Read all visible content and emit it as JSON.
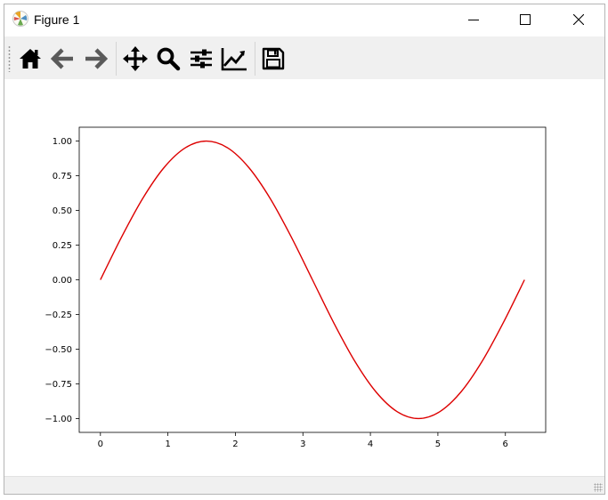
{
  "window": {
    "title": "Figure 1",
    "app_icon": "matplotlib-icon",
    "controls": [
      "minimize-icon",
      "maximize-icon",
      "close-icon"
    ]
  },
  "toolbar": {
    "tools": [
      {
        "name": "home",
        "icon": "home-icon"
      },
      {
        "name": "back",
        "icon": "arrow-left-icon"
      },
      {
        "name": "forward",
        "icon": "arrow-right-icon"
      },
      {
        "name": "pan",
        "icon": "move-icon"
      },
      {
        "name": "zoom",
        "icon": "magnifier-icon"
      },
      {
        "name": "subplots",
        "icon": "sliders-icon"
      },
      {
        "name": "edit-axes",
        "icon": "line-chart-icon"
      },
      {
        "name": "save",
        "icon": "floppy-disk-icon"
      }
    ]
  },
  "colors": {
    "line": "#dd0000",
    "toolbar_bg": "#f0f0f0"
  },
  "chart_data": {
    "type": "line",
    "title": "",
    "xlabel": "",
    "ylabel": "",
    "xlim": [
      -0.314,
      6.597
    ],
    "ylim": [
      -1.1,
      1.1
    ],
    "xticks": [
      0,
      1,
      2,
      3,
      4,
      5,
      6
    ],
    "xtick_labels": [
      "0",
      "1",
      "2",
      "3",
      "4",
      "5",
      "6"
    ],
    "yticks": [
      -1.0,
      -0.75,
      -0.5,
      -0.25,
      0.0,
      0.25,
      0.5,
      0.75,
      1.0
    ],
    "ytick_labels": [
      "−1.00",
      "−0.75",
      "−0.50",
      "−0.25",
      "0.00",
      "0.25",
      "0.50",
      "0.75",
      "1.00"
    ],
    "grid": false,
    "series": [
      {
        "color": "#dd0000",
        "x": [
          0,
          0.3142,
          0.6283,
          0.9425,
          1.2566,
          1.5708,
          1.885,
          2.1991,
          2.5133,
          2.8274,
          3.1416,
          3.4558,
          3.7699,
          4.0841,
          4.3982,
          4.7124,
          5.0265,
          5.3407,
          5.6549,
          5.969,
          6.2832
        ],
        "y": [
          0,
          0.309,
          0.5878,
          0.809,
          0.9511,
          1.0,
          0.9511,
          0.809,
          0.5878,
          0.309,
          0,
          -0.309,
          -0.5878,
          -0.809,
          -0.9511,
          -1.0,
          -0.9511,
          -0.809,
          -0.5878,
          -0.309,
          0
        ]
      }
    ]
  }
}
